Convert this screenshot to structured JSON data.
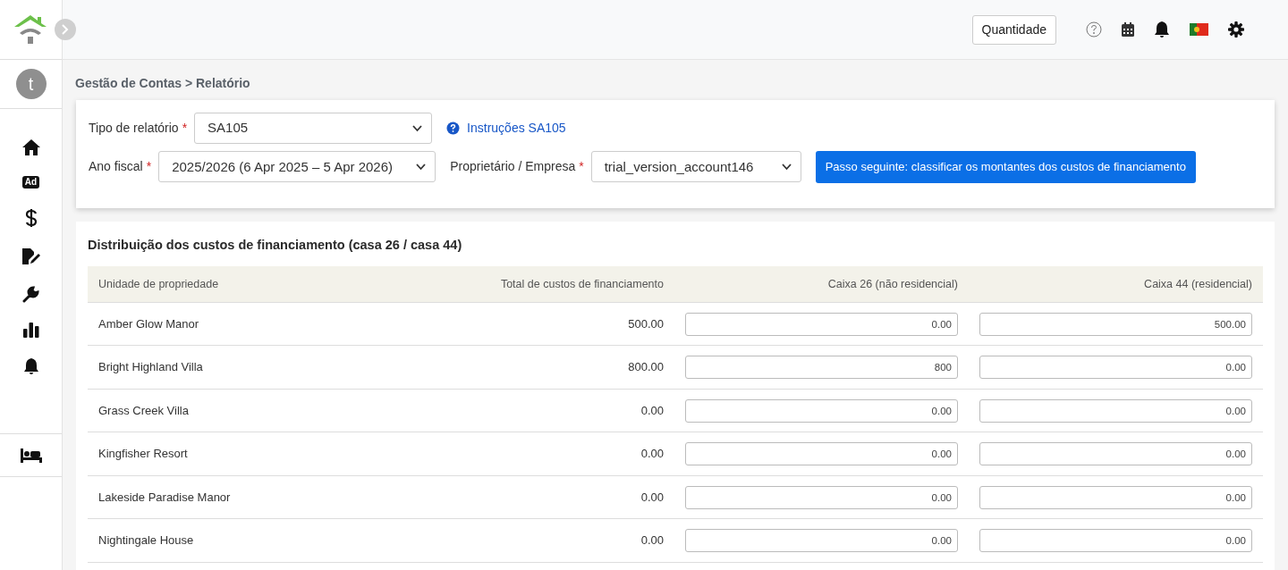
{
  "top_bar": {
    "quantity_button": "Quantidade"
  },
  "sidebar": {
    "avatar": "t",
    "ad_label": "Ad"
  },
  "breadcrumb": "Gestão de Contas > Relatório",
  "form": {
    "report_type": {
      "label": "Tipo de relatório",
      "required_mark": "*",
      "value": "SA105"
    },
    "instructions_link": "Instruções SA105",
    "fiscal_year": {
      "label": "Ano fiscal",
      "required_mark": "*",
      "value": "2025/2026 (6 Apr 2025 – 5 Apr 2026)"
    },
    "owner": {
      "label": "Proprietário / Empresa",
      "required_mark": "*",
      "value": "trial_version_account146"
    },
    "next_button": "Passo seguinte: classificar os montantes dos custos de financiamento"
  },
  "table": {
    "title": "Distribuição dos custos de financiamento (casa 26 / casa 44)",
    "columns": [
      "Unidade de propriedade",
      "Total de custos de financiamento",
      "Caixa 26 (não residencial)",
      "Caixa 44 (residencial)"
    ],
    "rows": [
      {
        "property": "Amber Glow Manor",
        "total": "500.00",
        "box_26": "0.00",
        "box_44": "500.00"
      },
      {
        "property": "Bright Highland Villa",
        "total": "800.00",
        "box_26": "800",
        "box_44": "0.00"
      },
      {
        "property": "Grass Creek Villa",
        "total": "0.00",
        "box_26": "0.00",
        "box_44": "0.00"
      },
      {
        "property": "Kingfisher Resort",
        "total": "0.00",
        "box_26": "0.00",
        "box_44": "0.00"
      },
      {
        "property": "Lakeside Paradise Manor",
        "total": "0.00",
        "box_26": "0.00",
        "box_44": "0.00"
      },
      {
        "property": "Nightingale House",
        "total": "0.00",
        "box_26": "0.00",
        "box_44": "0.00"
      }
    ]
  }
}
